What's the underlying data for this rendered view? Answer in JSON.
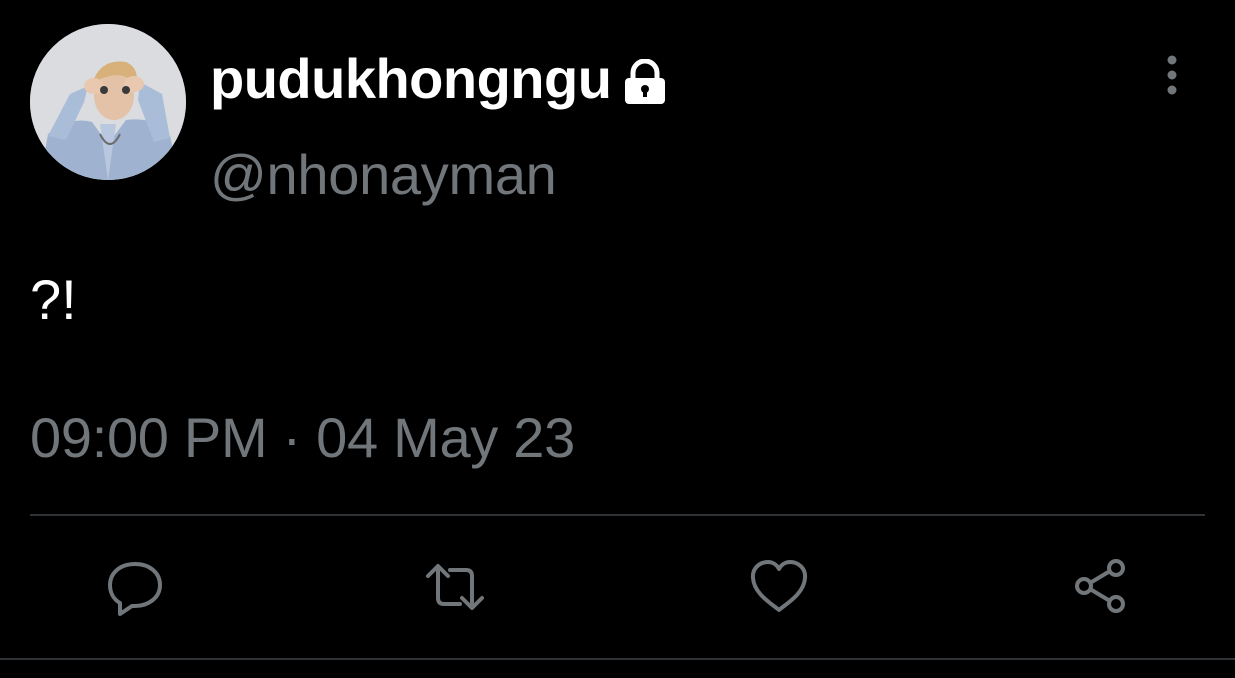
{
  "tweet": {
    "display_name": "pudukhongngu",
    "handle": "@nhonayman",
    "protected": true,
    "text": "?!",
    "timestamp": "09:00 PM · 04 May 23"
  },
  "icons": {
    "lock": "lock-icon",
    "more": "more-vertical-icon",
    "reply": "reply-icon",
    "retweet": "retweet-icon",
    "like": "heart-icon",
    "share": "share-icon"
  },
  "colors": {
    "background": "#000000",
    "primary_text": "#ffffff",
    "secondary_text": "#71767b",
    "divider": "#2f3336"
  }
}
